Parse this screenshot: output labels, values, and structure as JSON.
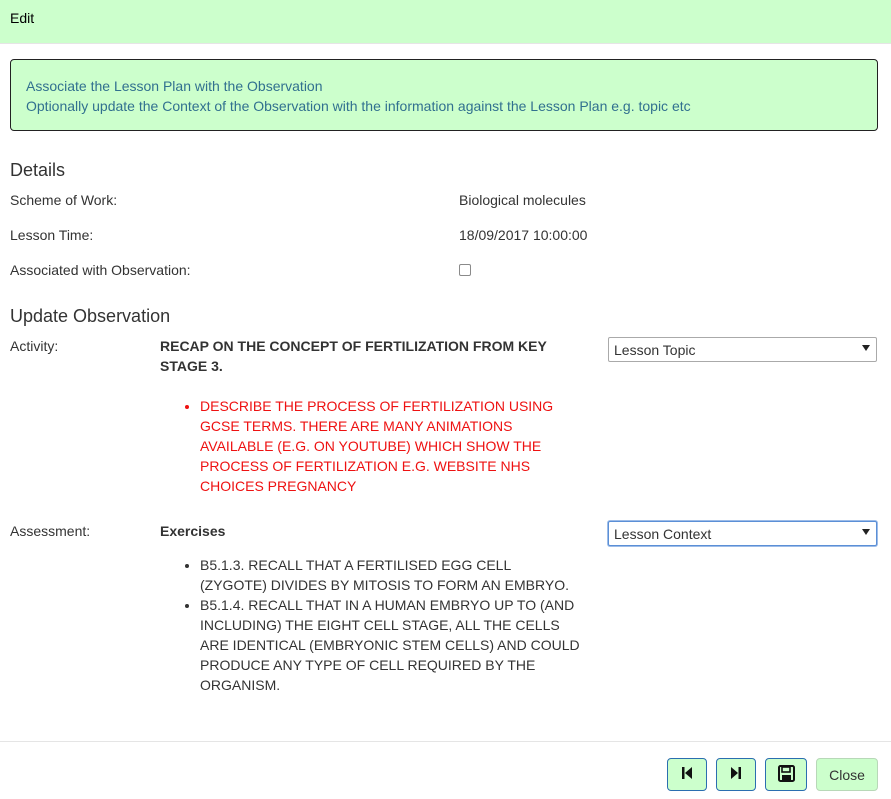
{
  "header": {
    "title": "Edit"
  },
  "info": {
    "line1": "Associate the Lesson Plan with the Observation",
    "line2": "Optionally update the Context of the Observation with the information against the Lesson Plan e.g. topic etc"
  },
  "details": {
    "title": "Details",
    "scheme_label": "Scheme of Work:",
    "scheme_value": "Biological molecules",
    "time_label": "Lesson Time:",
    "time_value": "18/09/2017 10:00:00",
    "assoc_label": "Associated with Observation:",
    "assoc_checked": false
  },
  "update": {
    "title": "Update Observation",
    "activity_label": "Activity:",
    "activity_heading": "RECAP ON THE CONCEPT OF FERTILIZATION FROM KEY STAGE 3.",
    "activity_items": [
      "DESCRIBE THE PROCESS OF FERTILIZATION USING GCSE TERMS. THERE ARE MANY ANIMATIONS AVAILABLE (E.G. ON YOUTUBE) WHICH SHOW THE PROCESS OF FERTILIZATION E.G. WEBSITE NHS CHOICES PREGNANCY"
    ],
    "activity_select": "Lesson Topic",
    "assessment_label": "Assessment:",
    "assessment_heading": "Exercises",
    "assessment_items": [
      "B5.1.3. RECALL THAT A FERTILISED EGG CELL (ZYGOTE) DIVIDES BY MITOSIS TO FORM AN EMBRYO.",
      "B5.1.4. RECALL THAT IN A HUMAN EMBRYO UP TO (AND INCLUDING) THE EIGHT CELL STAGE, ALL THE CELLS ARE IDENTICAL (EMBRYONIC STEM CELLS) AND COULD PRODUCE ANY TYPE OF CELL REQUIRED BY THE ORGANISM."
    ],
    "assessment_select": "Lesson Context"
  },
  "footer": {
    "prev_icon": "skip-previous-icon",
    "next_icon": "skip-next-icon",
    "save_icon": "floppy-disk-icon",
    "close_label": "Close"
  },
  "colors": {
    "header_bg": "#ccffcc",
    "info_text": "#31708f",
    "activity_text": "#ee1111",
    "button_border": "#2b6eb0"
  }
}
